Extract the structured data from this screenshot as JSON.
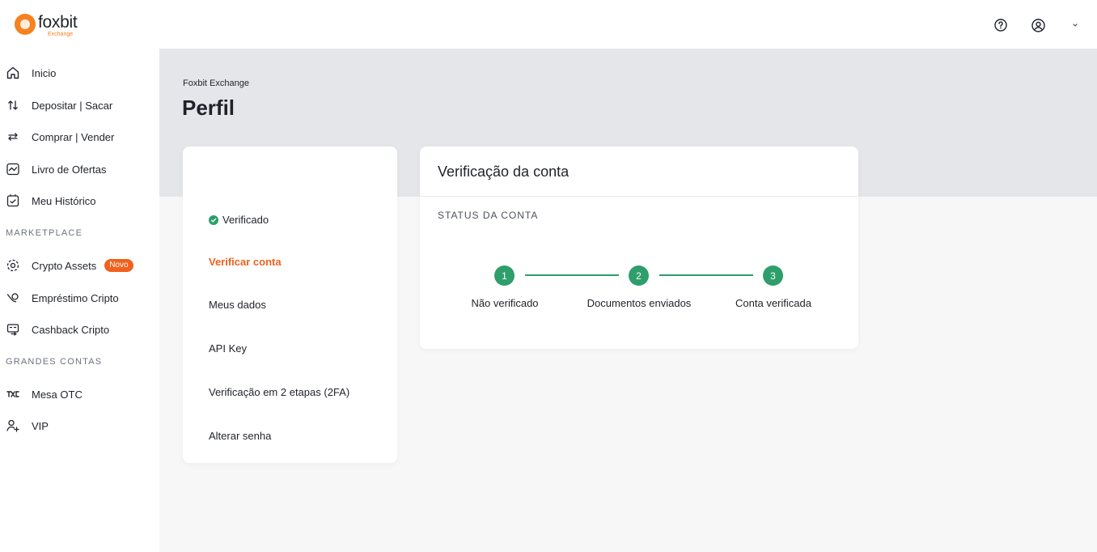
{
  "header": {
    "logo_name": "foxbit",
    "logo_sub": "Exchange",
    "icons": [
      "help-circle-icon",
      "user-circle-icon",
      "chevron-down-icon"
    ]
  },
  "sidebar": {
    "items": [
      {
        "label": "Inicio",
        "icon": "home-icon"
      },
      {
        "label": "Depositar | Sacar",
        "icon": "arrows-up-down-icon"
      },
      {
        "label": "Comprar | Vender",
        "icon": "arrows-left-right-icon"
      },
      {
        "label": "Livro de Ofertas",
        "icon": "chart-line-icon"
      },
      {
        "label": "Meu Histórico",
        "icon": "history-icon"
      }
    ],
    "section_marketplace": "MARKETPLACE",
    "marketplace_items": [
      {
        "label": "Crypto Assets",
        "icon": "crypto-assets-icon",
        "badge": "Novo"
      },
      {
        "label": "Empréstimo Cripto",
        "icon": "loan-icon"
      },
      {
        "label": "Cashback Cripto",
        "icon": "cashback-icon"
      }
    ],
    "section_grandes": "GRANDES CONTAS",
    "grandes_items": [
      {
        "label": "Mesa OTC",
        "icon": "otc-icon"
      },
      {
        "label": "VIP",
        "icon": "user-plus-icon"
      }
    ]
  },
  "main": {
    "breadcrumb": "Foxbit Exchange",
    "title": "Perfil",
    "profile_menu": {
      "status": "Verificado",
      "items": [
        {
          "label": "Verificar conta",
          "active": true
        },
        {
          "label": "Meus dados",
          "active": false
        },
        {
          "label": "API Key",
          "active": false
        },
        {
          "label": "Verificação em 2 etapas (2FA)",
          "active": false
        },
        {
          "label": "Alterar senha",
          "active": false
        }
      ]
    },
    "verification": {
      "title": "Verificação da conta",
      "status_label": "STATUS DA CONTA",
      "steps": [
        {
          "number": "1",
          "label": "Não verificado"
        },
        {
          "number": "2",
          "label": "Documentos enviados"
        },
        {
          "number": "3",
          "label": "Conta verificada"
        }
      ]
    }
  },
  "colors": {
    "accent_orange": "#f0611e",
    "success_green": "#2e9e6b",
    "band_gray": "#e5e6ea"
  }
}
